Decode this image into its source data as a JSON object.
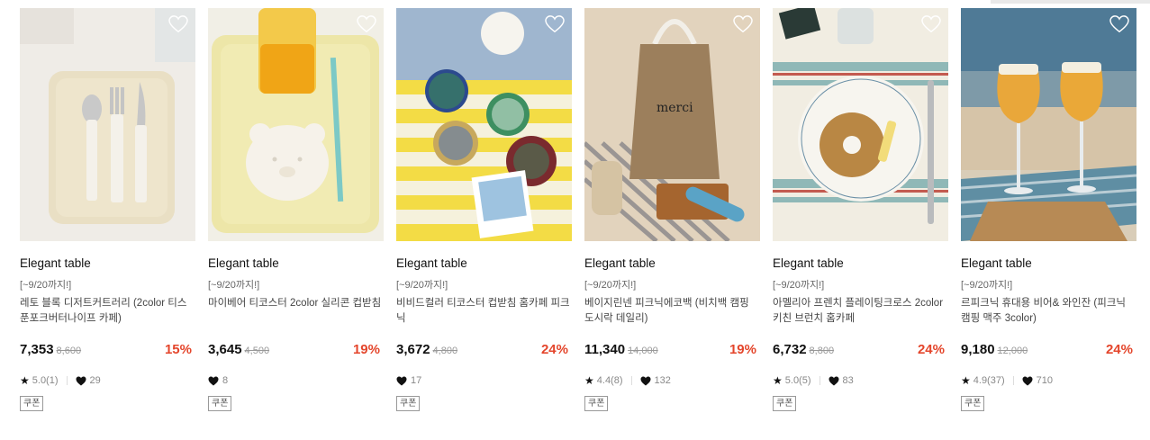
{
  "coupon_label": "쿠폰",
  "products": [
    {
      "brand": "Elegant table",
      "promo": "[~9/20까지!]",
      "name": "레토 블록 디저트커트러리 (2color 티스푼포크버터나이프 카페)",
      "price": "7,353",
      "original_price": "8,600",
      "discount": "15%",
      "rating": "5.0(1)",
      "likes": "29",
      "icon": "cutlery-tray-image"
    },
    {
      "brand": "Elegant table",
      "promo": "[~9/20까지!]",
      "name": "마이베어 티코스터 2color 실리콘 컵받침",
      "price": "3,645",
      "original_price": "4,500",
      "discount": "19%",
      "rating": "",
      "likes": "8",
      "icon": "bear-coaster-image"
    },
    {
      "brand": "Elegant table",
      "promo": "[~9/20까지!]",
      "name": "비비드컬러 티코스터 컵받침 홈카페 피크닉",
      "price": "3,672",
      "original_price": "4,800",
      "discount": "24%",
      "rating": "",
      "likes": "17",
      "icon": "checker-coasters-image"
    },
    {
      "brand": "Elegant table",
      "promo": "[~9/20까지!]",
      "name": "베이지린넨 피크닉에코백 (비치백 캠핑 도시락 데일리)",
      "price": "11,340",
      "original_price": "14,000",
      "discount": "19%",
      "rating": "4.4(8)",
      "likes": "132",
      "icon": "merci-tote-bag-image"
    },
    {
      "brand": "Elegant table",
      "promo": "[~9/20까지!]",
      "name": "아멜리아 프렌치 플레이팅크로스 2color 키친 브런치 홈카페",
      "price": "6,732",
      "original_price": "8,800",
      "discount": "24%",
      "rating": "5.0(5)",
      "likes": "83",
      "icon": "bagel-plate-image"
    },
    {
      "brand": "Elegant table",
      "promo": "[~9/20까지!]",
      "name": "르피크닉 휴대용 비어& 와인잔 (피크닉 캠핑 맥주 3color)",
      "price": "9,180",
      "original_price": "12,000",
      "discount": "24%",
      "rating": "4.9(37)",
      "likes": "710",
      "icon": "beer-glasses-image"
    }
  ]
}
